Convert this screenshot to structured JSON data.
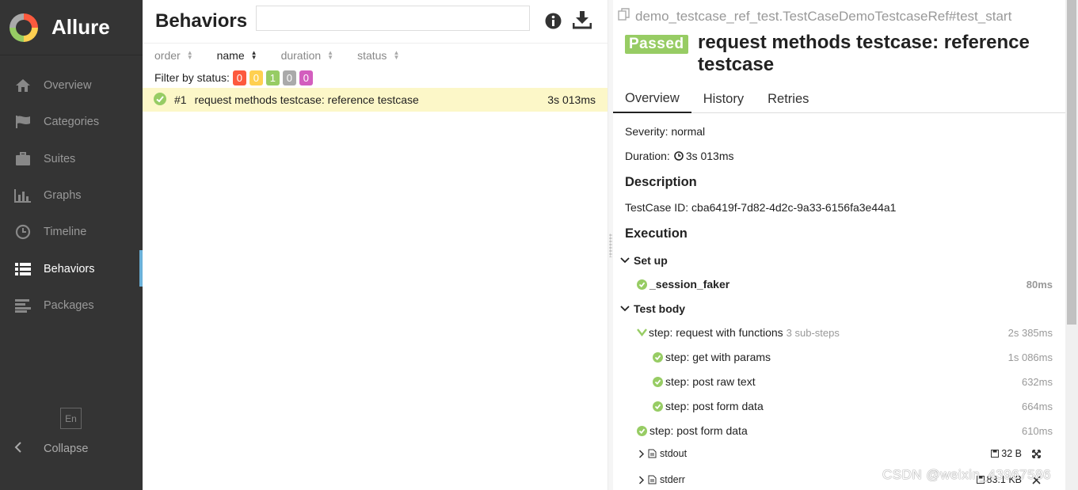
{
  "brand": {
    "name": "Allure"
  },
  "sidebar": {
    "items": [
      {
        "label": "Overview",
        "icon": "home-icon"
      },
      {
        "label": "Categories",
        "icon": "flag-icon"
      },
      {
        "label": "Suites",
        "icon": "briefcase-icon"
      },
      {
        "label": "Graphs",
        "icon": "bar-chart-icon"
      },
      {
        "label": "Timeline",
        "icon": "clock-icon"
      },
      {
        "label": "Behaviors",
        "icon": "list-icon",
        "active": true
      },
      {
        "label": "Packages",
        "icon": "align-left-icon"
      }
    ],
    "language": "En",
    "collapse_label": "Collapse"
  },
  "behaviors": {
    "title": "Behaviors",
    "search_placeholder": "",
    "sort": [
      {
        "label": "order"
      },
      {
        "label": "name",
        "active": true
      },
      {
        "label": "duration"
      },
      {
        "label": "status"
      }
    ],
    "filter_label": "Filter by status:",
    "status_counts": [
      {
        "value": "0",
        "color": "#fd5a3e"
      },
      {
        "value": "0",
        "color": "#ffd050"
      },
      {
        "value": "1",
        "color": "#97cc64"
      },
      {
        "value": "0",
        "color": "#aaaaaa"
      },
      {
        "value": "0",
        "color": "#d35ebe"
      }
    ],
    "rows": [
      {
        "num": "#1",
        "name": "request methods testcase: reference testcase",
        "duration": "3s 013ms"
      }
    ]
  },
  "testcase": {
    "breadcrumb": "demo_testcase_ref_test.TestCaseDemoTestcaseRef#test_start",
    "status": "Passed",
    "title": "request methods testcase: reference testcase",
    "tabs": [
      "Overview",
      "History",
      "Retries"
    ],
    "severity": "Severity: normal",
    "duration_label": "Duration:",
    "duration": "3s 013ms",
    "description_heading": "Description",
    "description": "TestCase ID: cba6419f-7d82-4d2c-9a33-6156fa3e44a1",
    "execution_heading": "Execution",
    "setup_heading": "Set up",
    "setup_step": {
      "name": "_session_faker",
      "time": "80ms"
    },
    "testbody_heading": "Test body",
    "steps": [
      {
        "name": "step: request with functions",
        "sub": "3 sub-steps",
        "time": "2s 385ms"
      },
      {
        "name": "step: get with params",
        "time": "1s 086ms"
      },
      {
        "name": "step: post raw text",
        "time": "632ms"
      },
      {
        "name": "step: post form data",
        "time": "664ms"
      },
      {
        "name": "step: post form data",
        "time": "610ms"
      }
    ],
    "attachments": [
      {
        "name": "stdout",
        "size": "32 B"
      },
      {
        "name": "stderr",
        "size": "83.1 KB"
      }
    ]
  },
  "watermark": "CSDN @weixin_43967586",
  "colors": {
    "passed": "#97cc64",
    "sidebar": "#343434",
    "active_accent": "#6bb1d9",
    "selected_row": "#fcf7c8"
  }
}
